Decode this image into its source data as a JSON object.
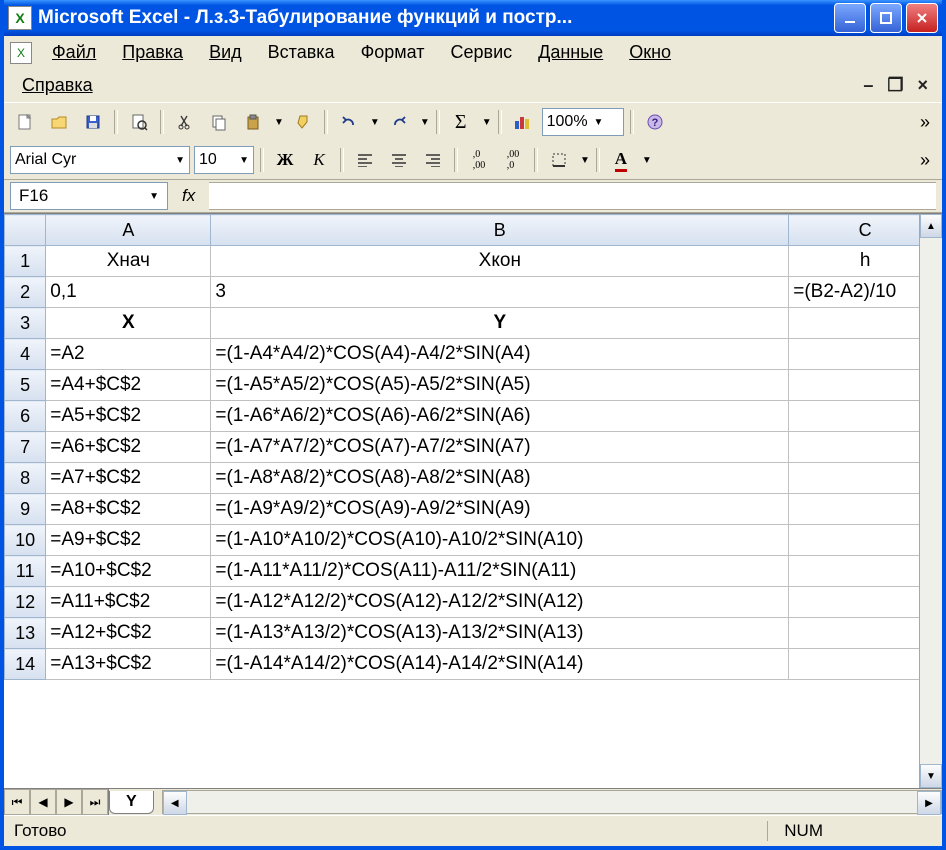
{
  "window": {
    "title": "Microsoft Excel - Л.з.3-Табулирование функций и постр..."
  },
  "menu": {
    "file": "Файл",
    "edit": "Правка",
    "view": "Вид",
    "insert": "Вставка",
    "format": "Формат",
    "tools": "Сервис",
    "data": "Данные",
    "window": "Окно",
    "help": "Справка"
  },
  "toolbar": {
    "zoom": "100%"
  },
  "format": {
    "font": "Arial Cyr",
    "size": "10"
  },
  "formula_bar": {
    "name_box": "F16",
    "fx": "fx",
    "value": ""
  },
  "columns": [
    "A",
    "B",
    "C"
  ],
  "rows": [
    {
      "n": "1",
      "a": "Хнач",
      "b": "Хкон",
      "c": "h",
      "center": true
    },
    {
      "n": "2",
      "a": "0,1",
      "b": "3",
      "c": "=(B2-A2)/10"
    },
    {
      "n": "3",
      "a": "X",
      "b": "Y",
      "c": "",
      "center": true,
      "bold": true
    },
    {
      "n": "4",
      "a": "=A2",
      "b": "=(1-A4*A4/2)*COS(A4)-A4/2*SIN(A4)",
      "c": ""
    },
    {
      "n": "5",
      "a": "=A4+$C$2",
      "b": "=(1-A5*A5/2)*COS(A5)-A5/2*SIN(A5)",
      "c": ""
    },
    {
      "n": "6",
      "a": "=A5+$C$2",
      "b": "=(1-A6*A6/2)*COS(A6)-A6/2*SIN(A6)",
      "c": ""
    },
    {
      "n": "7",
      "a": "=A6+$C$2",
      "b": "=(1-A7*A7/2)*COS(A7)-A7/2*SIN(A7)",
      "c": ""
    },
    {
      "n": "8",
      "a": "=A7+$C$2",
      "b": "=(1-A8*A8/2)*COS(A8)-A8/2*SIN(A8)",
      "c": ""
    },
    {
      "n": "9",
      "a": "=A8+$C$2",
      "b": "=(1-A9*A9/2)*COS(A9)-A9/2*SIN(A9)",
      "c": ""
    },
    {
      "n": "10",
      "a": "=A9+$C$2",
      "b": "=(1-A10*A10/2)*COS(A10)-A10/2*SIN(A10)",
      "c": ""
    },
    {
      "n": "11",
      "a": "=A10+$C$2",
      "b": "=(1-A11*A11/2)*COS(A11)-A11/2*SIN(A11)",
      "c": ""
    },
    {
      "n": "12",
      "a": "=A11+$C$2",
      "b": "=(1-A12*A12/2)*COS(A12)-A12/2*SIN(A12)",
      "c": ""
    },
    {
      "n": "13",
      "a": "=A12+$C$2",
      "b": "=(1-A13*A13/2)*COS(A13)-A13/2*SIN(A13)",
      "c": ""
    },
    {
      "n": "14",
      "a": "=A13+$C$2",
      "b": "=(1-A14*A14/2)*COS(A14)-A14/2*SIN(A14)",
      "c": ""
    }
  ],
  "sheet": {
    "active": "Y"
  },
  "status": {
    "ready": "Готово",
    "num": "NUM"
  }
}
